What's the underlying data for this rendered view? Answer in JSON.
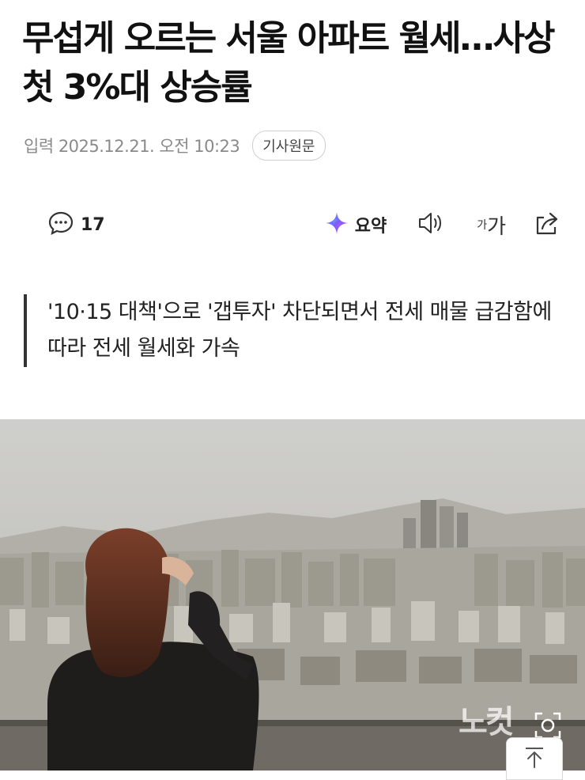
{
  "article": {
    "headline": "무섭게 오르는 서울 아파트 월세…사상 첫 3%대 상승률",
    "input_date": "입력 2025.12.21. 오전 10:23",
    "original_button": "기사원문",
    "subheading": "'10·15 대책'으로 '갭투자' 차단되면서 전세 매물 급감함에 따라 전세 월세화 가속"
  },
  "toolbar": {
    "comment_count": "17",
    "summary_label": "요약",
    "font_small": "가",
    "font_big": "가"
  },
  "photo": {
    "watermark": "노컷"
  },
  "icons": [
    "comment-icon",
    "sparkle-icon",
    "speaker-icon",
    "share-icon",
    "zoom-icon",
    "arrow-up-icon"
  ],
  "colors": {
    "text": "#111111",
    "meta": "#8a8a8a",
    "sky": "#cfcfcb"
  }
}
